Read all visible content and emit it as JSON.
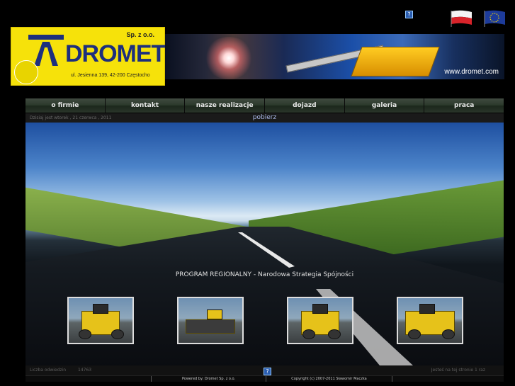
{
  "top": {
    "help_icon": "question-mark-icon",
    "help_glyph": "?",
    "flags": [
      "poland-flag",
      "eu-flag"
    ]
  },
  "logo": {
    "company": "DROMET",
    "legal_form": "Sp. z o.o.",
    "address": "ul. Jesienna 139, 42-200 Częstocho",
    "brand_color": "#f6e20a",
    "text_color": "#1d2f7d"
  },
  "banner": {
    "url": "www.dromet.com"
  },
  "nav": {
    "items": [
      {
        "label": "o firmie"
      },
      {
        "label": "kontakt"
      },
      {
        "label": "nasze realizacje"
      },
      {
        "label": "dojazd"
      },
      {
        "label": "galeria"
      },
      {
        "label": "praca"
      }
    ]
  },
  "infobar": {
    "today": "Dzisiaj jest wtorek , 21 czerwca , 2011",
    "download": "pobierz"
  },
  "hero": {
    "caption": "PROGRAM REGIONALNY - Narodowa Strategia Spójności"
  },
  "thumbnails": [
    {
      "name": "road-roller-photo"
    },
    {
      "name": "asphalt-paving-photo"
    },
    {
      "name": "paver-machine-photo"
    },
    {
      "name": "paver-front-photo"
    }
  ],
  "footer": {
    "visits_label": "Liczba odwiedzin",
    "visits_count": "14763",
    "online": "Jesteś na tej stronie 1 raz",
    "help_glyph": "?",
    "powered_by": "Powered by: Dromet Sp. z o.o.",
    "copyright": "Copyright (c) 2007-2011 Sławomir Maczka"
  }
}
